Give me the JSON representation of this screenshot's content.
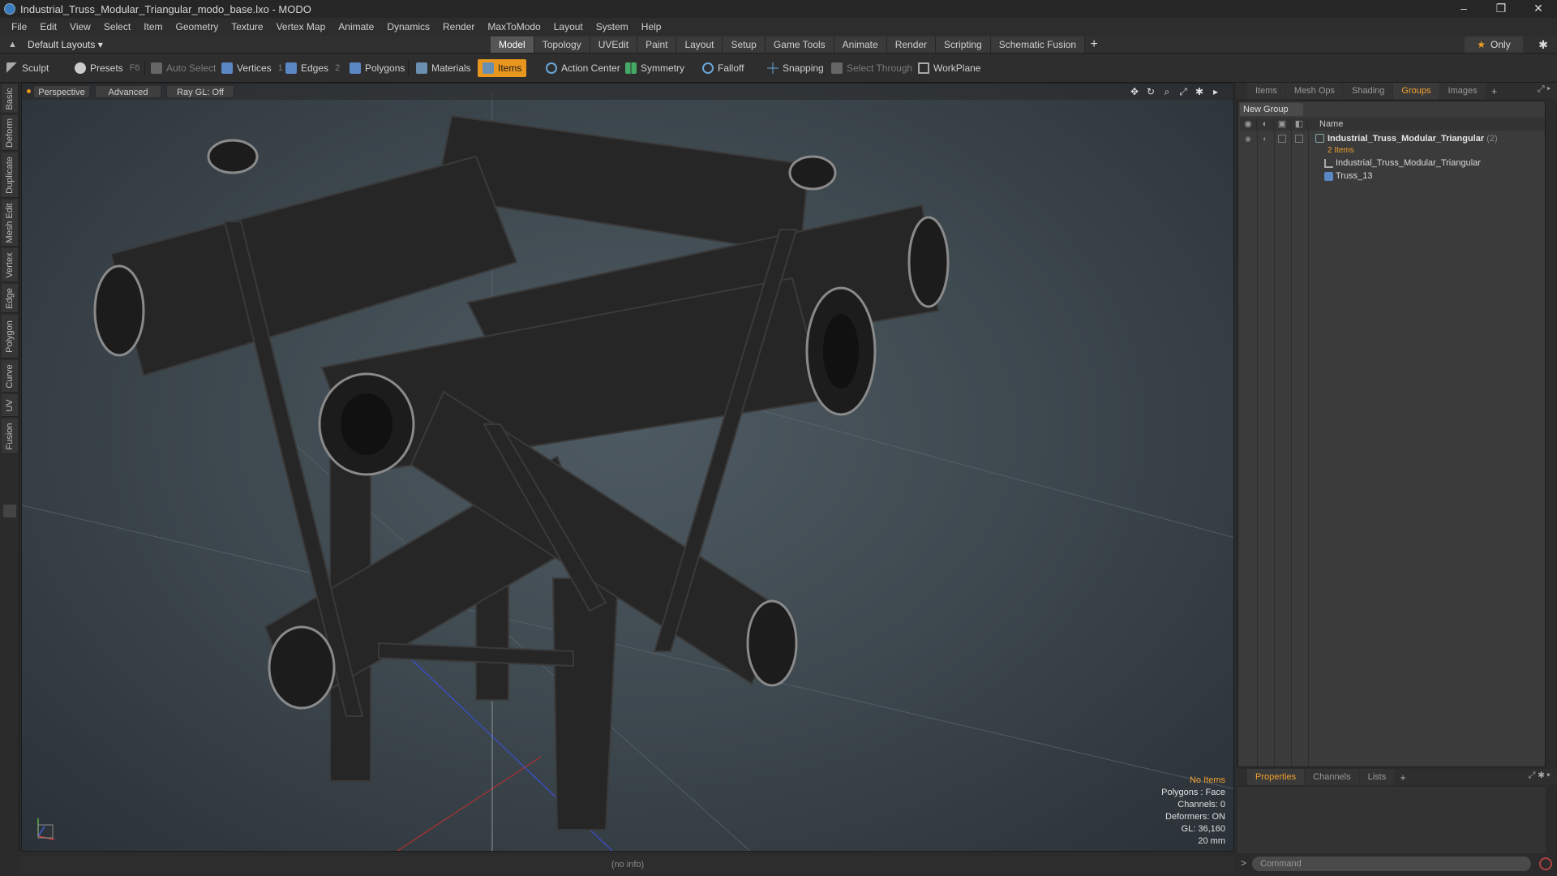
{
  "window": {
    "title": "Industrial_Truss_Modular_Triangular_modo_base.lxo - MODO",
    "controls": [
      "–",
      "❐",
      "✕"
    ]
  },
  "menu": [
    "File",
    "Edit",
    "View",
    "Select",
    "Item",
    "Geometry",
    "Texture",
    "Vertex Map",
    "Animate",
    "Dynamics",
    "Render",
    "MaxToModo",
    "Layout",
    "System",
    "Help"
  ],
  "layout_selector": "Default Layouts ▾",
  "layout_tabs": [
    {
      "label": "Model",
      "active": true
    },
    {
      "label": "Topology",
      "active": false
    },
    {
      "label": "UVEdit",
      "active": false
    },
    {
      "label": "Paint",
      "active": false
    },
    {
      "label": "Layout",
      "active": false
    },
    {
      "label": "Setup",
      "active": false
    },
    {
      "label": "Game Tools",
      "active": false
    },
    {
      "label": "Animate",
      "active": false
    },
    {
      "label": "Render",
      "active": false
    },
    {
      "label": "Scripting",
      "active": false
    },
    {
      "label": "Schematic Fusion",
      "active": false
    }
  ],
  "only_label": "Only",
  "toolbar": {
    "sculpt": "Sculpt",
    "presets": "Presets",
    "presets_key": "F6",
    "auto_select": "Auto Select",
    "vertices": "Vertices",
    "vertices_count": "1",
    "edges": "Edges",
    "edges_count": "2",
    "polygons": "Polygons",
    "materials": "Materials",
    "items": "Items",
    "action_center": "Action Center",
    "symmetry": "Symmetry",
    "falloff": "Falloff",
    "snapping": "Snapping",
    "select_through": "Select Through",
    "workplane": "WorkPlane"
  },
  "left_tabs": [
    "Basic",
    "Deform",
    "Duplicate",
    "Mesh Edit",
    "Vertex",
    "Edge",
    "Polygon",
    "Curve",
    "UV",
    "Fusion"
  ],
  "viewport": {
    "view": "Perspective",
    "shading": "Advanced",
    "raygl": "Ray GL: Off",
    "hud": {
      "selection": "No Items",
      "polygons": "Polygons : Face",
      "channels": "Channels: 0",
      "deformers": "Deformers: ON",
      "gl": "GL: 36,160",
      "scale": "20 mm"
    }
  },
  "status_text": "(no info)",
  "right_panel": {
    "top_tabs": [
      {
        "label": "Items",
        "active": false
      },
      {
        "label": "Mesh Ops",
        "active": false
      },
      {
        "label": "Shading",
        "active": false
      },
      {
        "label": "Groups",
        "active": true
      },
      {
        "label": "Images",
        "active": false
      }
    ],
    "new_group": "New Group",
    "name_header": "Name",
    "group_name": "Industrial_Truss_Modular_Triangular",
    "group_count": "(2)",
    "group_sub": "2 Items",
    "children": [
      "Industrial_Truss_Modular_Triangular",
      "Truss_13"
    ],
    "bottom_tabs": [
      {
        "label": "Properties",
        "active": true
      },
      {
        "label": "Channels",
        "active": false
      },
      {
        "label": "Lists",
        "active": false
      }
    ]
  },
  "command": {
    "placeholder": "Command"
  },
  "colors": {
    "accent": "#e8961e",
    "background": "#2b2b2b"
  }
}
